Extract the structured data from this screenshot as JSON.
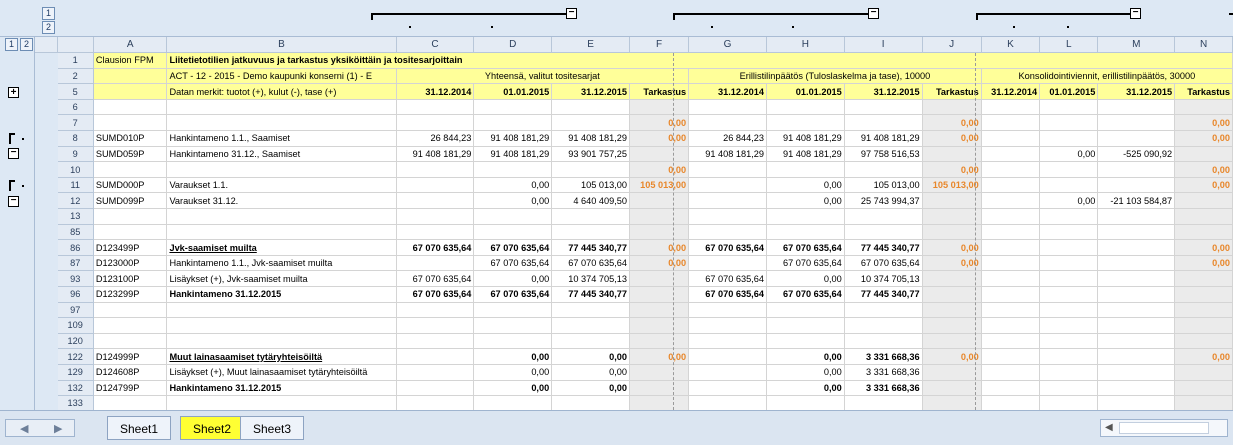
{
  "outline": {
    "levels": [
      "1",
      "2"
    ],
    "row_levels": [
      "1",
      "2"
    ],
    "expand": "+",
    "collapse": "−",
    "bullet": "·"
  },
  "columns": [
    "A",
    "B",
    "C",
    "D",
    "E",
    "F",
    "G",
    "H",
    "I",
    "J",
    "K",
    "L",
    "M",
    "N"
  ],
  "rows": [
    {
      "n": "1",
      "A": "Clausion FPM",
      "B": "Liitetietotilien jatkuvuus ja tarkastus yksiköittäin ja tositesarjoittain"
    },
    {
      "n": "2",
      "A": "",
      "B": "ACT - 12 - 2015 - Demo kaupunki konserni (1) - E",
      "group1": "Yhteensä, valitut tositesarjat",
      "group2": "Erillistilinpäätös (Tuloslaskelma ja tase), 10000",
      "group3": "Konsolidointiviennit, erillistilinpäätös, 30000"
    },
    {
      "n": "5",
      "B": "Datan merkit: tuotot (+), kulut (-), tase (+)",
      "C": "31.12.2014",
      "D": "01.01.2015",
      "E": "31.12.2015",
      "F": "Tarkastus",
      "G": "31.12.2014",
      "H": "01.01.2015",
      "I": "31.12.2015",
      "J": "Tarkastus",
      "K": "31.12.2014",
      "L": "01.01.2015",
      "M": "31.12.2015",
      "N": "Tarkastus"
    },
    {
      "n": "6"
    },
    {
      "n": "7",
      "F": "0,00",
      "J": "0,00",
      "N": "0,00"
    },
    {
      "n": "8",
      "A": "SUMD010P",
      "B": "Hankintameno 1.1., Saamiset",
      "C": "26 844,23",
      "D": "91 408 181,29",
      "E": "91 408 181,29",
      "F": "0,00",
      "G": "26 844,23",
      "H": "91 408 181,29",
      "I": "91 408 181,29",
      "J": "0,00",
      "N": "0,00"
    },
    {
      "n": "9",
      "A": "SUMD059P",
      "B": "Hankintameno 31.12., Saamiset",
      "C": "91 408 181,29",
      "D": "91 408 181,29",
      "E": "93 901 757,25",
      "G": "91 408 181,29",
      "H": "91 408 181,29",
      "I": "97 758 516,53",
      "L": "0,00",
      "M": "-525 090,92"
    },
    {
      "n": "10",
      "F": "0,00",
      "J": "0,00",
      "N": "0,00"
    },
    {
      "n": "11",
      "A": "SUMD000P",
      "B": "Varaukset 1.1.",
      "D": "0,00",
      "E": "105 013,00",
      "F": "105 013,00",
      "H": "0,00",
      "I": "105 013,00",
      "J": "105 013,00",
      "N": "0,00"
    },
    {
      "n": "12",
      "A": "SUMD099P",
      "B": "Varaukset 31.12.",
      "D": "0,00",
      "E": "4 640 409,50",
      "H": "0,00",
      "I": "25 743 994,37",
      "L": "0,00",
      "M": "-21 103 584,87"
    },
    {
      "n": "13"
    },
    {
      "n": "85"
    },
    {
      "n": "86",
      "A": "D123499P",
      "B": "Jvk-saamiset muilta",
      "C": "67 070 635,64",
      "D": "67 070 635,64",
      "E": "77 445 340,77",
      "F": "0,00",
      "G": "67 070 635,64",
      "H": "67 070 635,64",
      "I": "77 445 340,77",
      "J": "0,00",
      "N": "0,00"
    },
    {
      "n": "87",
      "A": "D123000P",
      "B": "Hankintameno 1.1., Jvk-saamiset muilta",
      "D": "67 070 635,64",
      "E": "67 070 635,64",
      "F": "0,00",
      "H": "67 070 635,64",
      "I": "67 070 635,64",
      "J": "0,00",
      "N": "0,00"
    },
    {
      "n": "93",
      "A": "D123100P",
      "B": "Lisäykset (+), Jvk-saamiset muilta",
      "C": "67 070 635,64",
      "D": "0,00",
      "E": "10 374 705,13",
      "G": "67 070 635,64",
      "H": "0,00",
      "I": "10 374 705,13"
    },
    {
      "n": "96",
      "A": "D123299P",
      "B": "Hankintameno 31.12.2015",
      "C": "67 070 635,64",
      "D": "67 070 635,64",
      "E": "77 445 340,77",
      "G": "67 070 635,64",
      "H": "67 070 635,64",
      "I": "77 445 340,77"
    },
    {
      "n": "97"
    },
    {
      "n": "109"
    },
    {
      "n": "120"
    },
    {
      "n": "122",
      "A": "D124999P",
      "B": "Muut lainasaamiset tytäryhteisöiltä",
      "D": "0,00",
      "E": "0,00",
      "F": "0,00",
      "H": "0,00",
      "I": "3 331 668,36",
      "J": "0,00",
      "N": "0,00"
    },
    {
      "n": "129",
      "A": "D124608P",
      "B": "Lisäykset (+), Muut lainasaamiset tytäryhteisöiltä",
      "D": "0,00",
      "E": "0,00",
      "H": "0,00",
      "I": "3 331 668,36"
    },
    {
      "n": "132",
      "A": "D124799P",
      "B": "Hankintameno 31.12.2015",
      "D": "0,00",
      "E": "0,00",
      "H": "0,00",
      "I": "3 331 668,36"
    },
    {
      "n": "133"
    }
  ],
  "sheets": [
    "Sheet1",
    "Sheet2",
    "Sheet3"
  ],
  "active_sheet": "Sheet2",
  "colors": {
    "header_yellow": "#ffff99",
    "check_grey": "#ebebeb",
    "check_orange": "#e8872b",
    "active_tab": "#ffff33"
  }
}
